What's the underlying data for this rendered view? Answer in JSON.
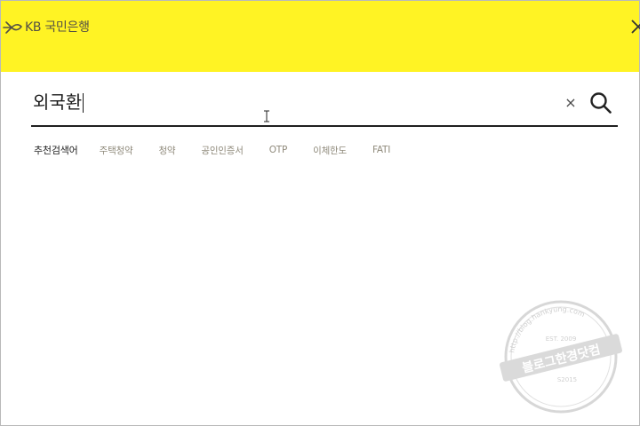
{
  "header": {
    "bank_name": "KB 국민은행",
    "close_icon": "close-icon",
    "background_color": "#fff324"
  },
  "search": {
    "value": "외국환",
    "clear_label": "×",
    "clear_icon": "clear-icon",
    "search_icon": "search-icon"
  },
  "recommended": {
    "label": "추천검색어",
    "keywords": [
      "주택청약",
      "청약",
      "공인인증서",
      "OTP",
      "이체한도",
      "FATI"
    ]
  },
  "watermark": {
    "text_main": "블로그한경닷컴",
    "text_url": "http://blog.hankyung.com",
    "text_est": "EST. 2009",
    "text_small": "S2015",
    "icon": "watermark-seal-icon"
  }
}
